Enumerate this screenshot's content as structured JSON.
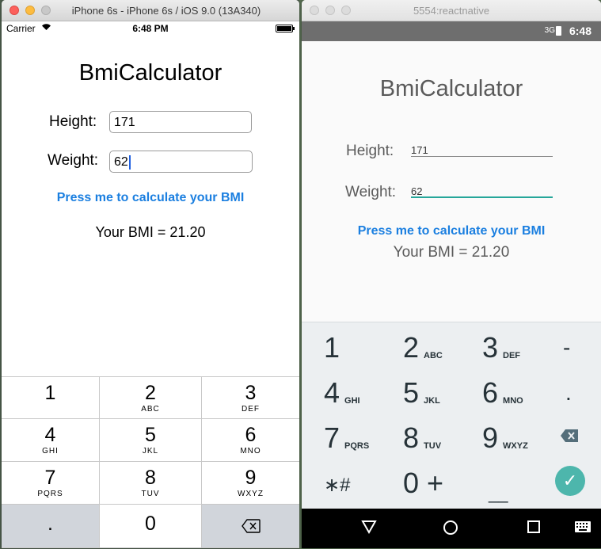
{
  "ios": {
    "window_title": "iPhone 6s - iPhone 6s / iOS 9.0 (13A340)",
    "status": {
      "carrier": "Carrier",
      "time": "6:48 PM"
    },
    "app_title": "BmiCalculator",
    "height_label": "Height:",
    "height_value": "171",
    "weight_label": "Weight:",
    "weight_value": "62",
    "button_label": "Press me to calculate your BMI",
    "result": "Your BMI = 21.20",
    "keypad": [
      {
        "num": "1",
        "sub": ""
      },
      {
        "num": "2",
        "sub": "ABC"
      },
      {
        "num": "3",
        "sub": "DEF"
      },
      {
        "num": "4",
        "sub": "GHI"
      },
      {
        "num": "5",
        "sub": "JKL"
      },
      {
        "num": "6",
        "sub": "MNO"
      },
      {
        "num": "7",
        "sub": "PQRS"
      },
      {
        "num": "8",
        "sub": "TUV"
      },
      {
        "num": "9",
        "sub": "WXYZ"
      },
      {
        "num": ".",
        "sub": ""
      },
      {
        "num": "0",
        "sub": ""
      }
    ]
  },
  "android": {
    "window_title": "5554:reactnative",
    "status": {
      "time": "6:48",
      "network": "3G"
    },
    "app_title": "BmiCalculator",
    "height_label": "Height:",
    "height_value": "171",
    "weight_label": "Weight:",
    "weight_value": "62",
    "button_label": "Press me to calculate your BMI",
    "result": "Your BMI = 21.20",
    "keypad": [
      {
        "num": "1",
        "sub": ""
      },
      {
        "num": "2",
        "sub": "ABC"
      },
      {
        "num": "3",
        "sub": "DEF"
      },
      {
        "num": "-",
        "sub": ""
      },
      {
        "num": "4",
        "sub": "GHI"
      },
      {
        "num": "5",
        "sub": "JKL"
      },
      {
        "num": "6",
        "sub": "MNO"
      },
      {
        "num": ".",
        "sub": ""
      },
      {
        "num": "7",
        "sub": "PQRS"
      },
      {
        "num": "8",
        "sub": "TUV"
      },
      {
        "num": "9",
        "sub": "WXYZ"
      },
      {
        "num": "∗#",
        "sub": ""
      },
      {
        "num": "0 +",
        "sub": ""
      },
      {
        "num": "__",
        "sub": ""
      }
    ],
    "colors": {
      "accent": "#26a69a",
      "done_button": "#4db6ac",
      "link": "#1b7fe0"
    }
  }
}
